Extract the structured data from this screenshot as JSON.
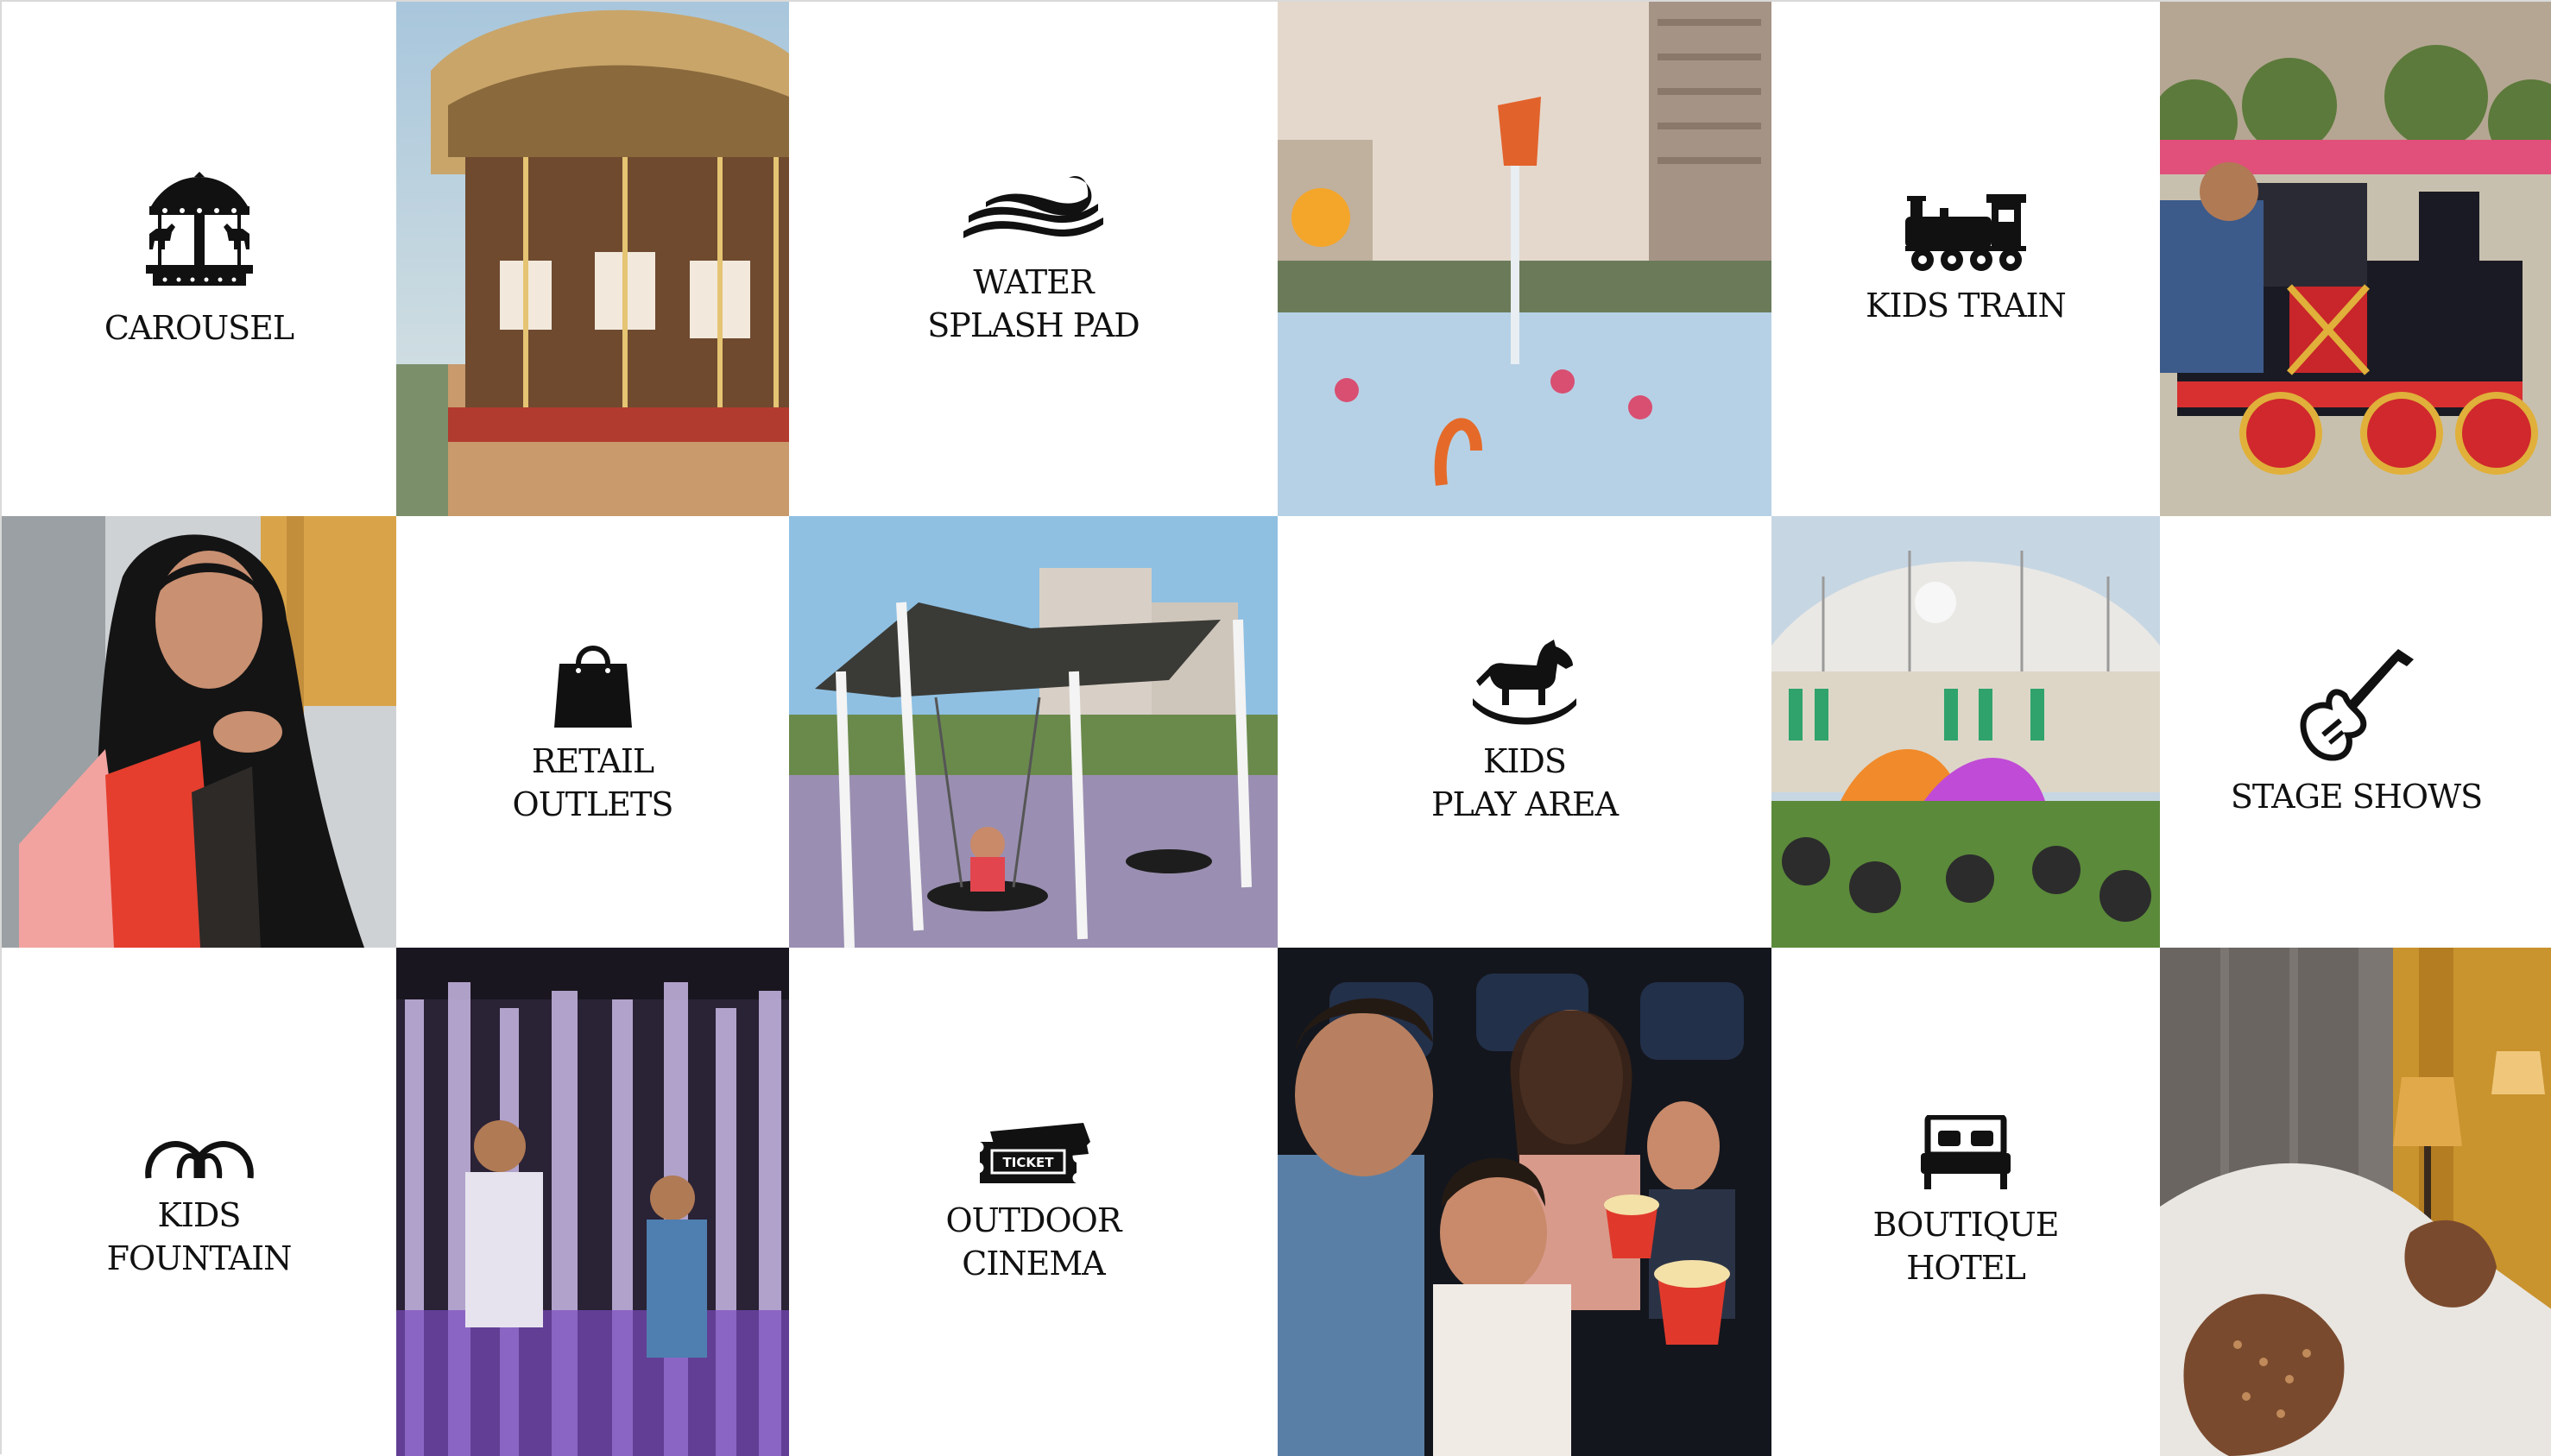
{
  "tiles": {
    "carousel": {
      "label": "CAROUSEL",
      "icon": "carousel-icon"
    },
    "water_splash_pad": {
      "label": "WATER\nSPLASH PAD",
      "icon": "water-wave-icon"
    },
    "kids_train": {
      "label": "KIDS TRAIN",
      "icon": "train-icon"
    },
    "retail_outlets": {
      "label": "RETAIL\nOUTLETS",
      "icon": "shopping-bag-icon"
    },
    "kids_play_area": {
      "label": "KIDS\nPLAY AREA",
      "icon": "rocking-horse-icon"
    },
    "stage_shows": {
      "label": "STAGE SHOWS",
      "icon": "electric-guitar-icon"
    },
    "kids_fountain": {
      "label": "KIDS\nFOUNTAIN",
      "icon": "fountain-icon"
    },
    "outdoor_cinema": {
      "label": "OUTDOOR\nCINEMA",
      "icon": "ticket-icon",
      "icon_text": "TICKET"
    },
    "boutique_hotel": {
      "label": "BOUTIQUE\nHOTEL",
      "icon": "bed-icon"
    }
  },
  "photos": [
    "carousel-photo",
    "splash-pad-photo",
    "kids-train-photo",
    "shopper-woman-photo",
    "playground-swings-photo",
    "stage-show-photo",
    "fountain-night-photo",
    "family-cinema-photo",
    "hotel-room-photo"
  ],
  "colors": {
    "icon": "#111111",
    "text": "#111111",
    "divider": "#d9d9d9"
  }
}
